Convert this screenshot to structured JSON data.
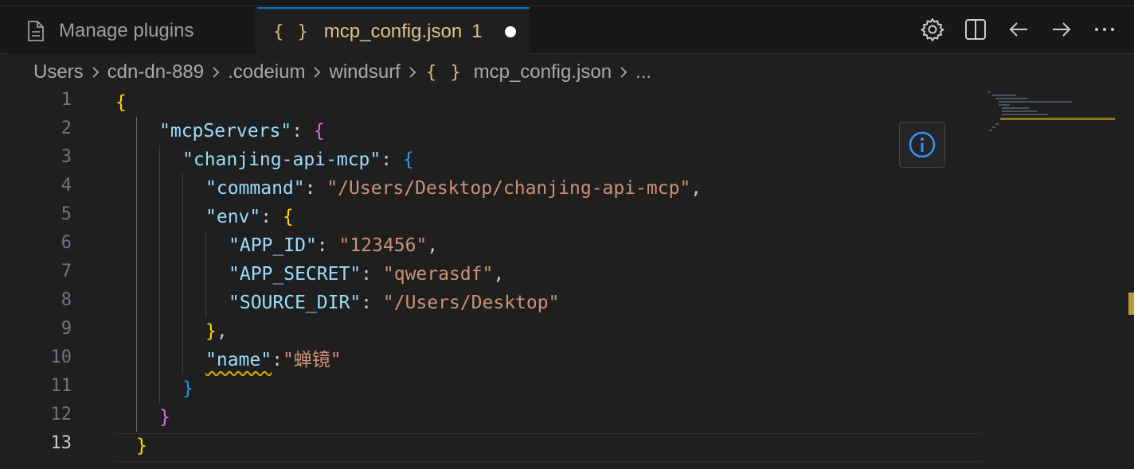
{
  "tabs": [
    {
      "label": "Manage plugins",
      "icon": "file-icon",
      "active": false
    },
    {
      "label": "mcp_config.json",
      "icon": "json-braces-icon",
      "active": true,
      "problem_count": "1",
      "dirty": true
    }
  ],
  "icons": {
    "json_braces": "{ }"
  },
  "actions": [
    {
      "name": "settings",
      "icon": "gear-icon"
    },
    {
      "name": "split-editor",
      "icon": "split-editor-icon"
    },
    {
      "name": "navigate-back",
      "icon": "arrow-left-icon"
    },
    {
      "name": "navigate-forward",
      "icon": "arrow-right-icon"
    },
    {
      "name": "more-actions",
      "icon": "ellipsis-icon"
    }
  ],
  "breadcrumb": [
    "Users",
    "cdn-dn-889",
    ".codeium",
    "windsurf",
    "mcp_config.json",
    "..."
  ],
  "editor": {
    "active_line": 13,
    "line_numbers": [
      "1",
      "2",
      "3",
      "4",
      "5",
      "6",
      "7",
      "8",
      "9",
      "10",
      "11",
      "12",
      "13"
    ],
    "tokens": {
      "l1_brace": "{",
      "l2_key": "\"mcpServers\"",
      "l2_colon": ": ",
      "l2_brace": "{",
      "l3_key": "\"chanjing-api-mcp\"",
      "l3_colon": ": ",
      "l3_brace": "{",
      "l4_key": "\"command\"",
      "l4_colon": ": ",
      "l4_value": "\"/Users/Desktop/chanjing-api-mcp\"",
      "l4_comma": ",",
      "l5_key": "\"env\"",
      "l5_colon": ": ",
      "l5_brace": "{",
      "l6_key": "\"APP_ID\"",
      "l6_colon": ": ",
      "l6_value": "\"123456\"",
      "l6_comma": ",",
      "l7_key": "\"APP_SECRET\"",
      "l7_colon": ": ",
      "l7_value": "\"qwerasdf\"",
      "l7_comma": ",",
      "l8_key": "\"SOURCE_DIR\"",
      "l8_colon": ": ",
      "l8_value": "\"/Users/Desktop\"",
      "l9_brace": "}",
      "l9_comma": ",",
      "l10_key": "\"name\"",
      "l10_colon": ":",
      "l10_value": "\"蝉镜\"",
      "l11_brace": "}",
      "l12_brace": "}",
      "l13_brace": "}"
    }
  },
  "info_button": {
    "icon": "info-icon"
  },
  "colors": {
    "background": "#1f1f1f",
    "key": "#9cdcfe",
    "string": "#ce9178",
    "bracket_level1": "#ffd700",
    "bracket_level2": "#da70d6",
    "bracket_level3": "#179fff",
    "modified_tab": "#e2c08d",
    "accent": "#0078d4",
    "warning": "#cca700"
  }
}
